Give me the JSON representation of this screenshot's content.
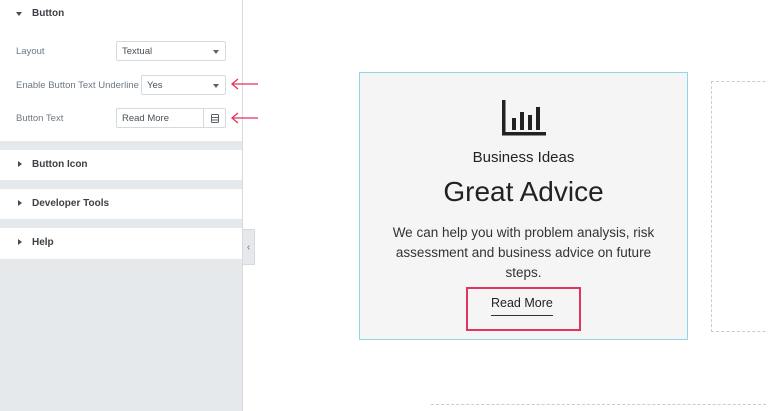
{
  "panel": {
    "button_section": {
      "title": "Button",
      "controls": [
        {
          "label": "Layout",
          "value": "Textual"
        },
        {
          "label": "Enable Button Text Underline",
          "value": "Yes"
        },
        {
          "label": "Button Text",
          "value": "Read More"
        }
      ]
    },
    "collapsed_sections": [
      {
        "title": "Button Icon"
      },
      {
        "title": "Developer Tools"
      },
      {
        "title": "Help"
      }
    ],
    "collapse_glyph": "‹"
  },
  "annotations": {
    "arrow_color": "#e1355e"
  },
  "card": {
    "icon": "bar-chart-icon",
    "subtitle": "Business Ideas",
    "title": "Great Advice",
    "description": "We can help you with problem analysis, risk assessment and business advice on future steps.",
    "button_label": "Read More",
    "border_color": "#8fd6e8",
    "highlight_color": "#e1355e"
  }
}
